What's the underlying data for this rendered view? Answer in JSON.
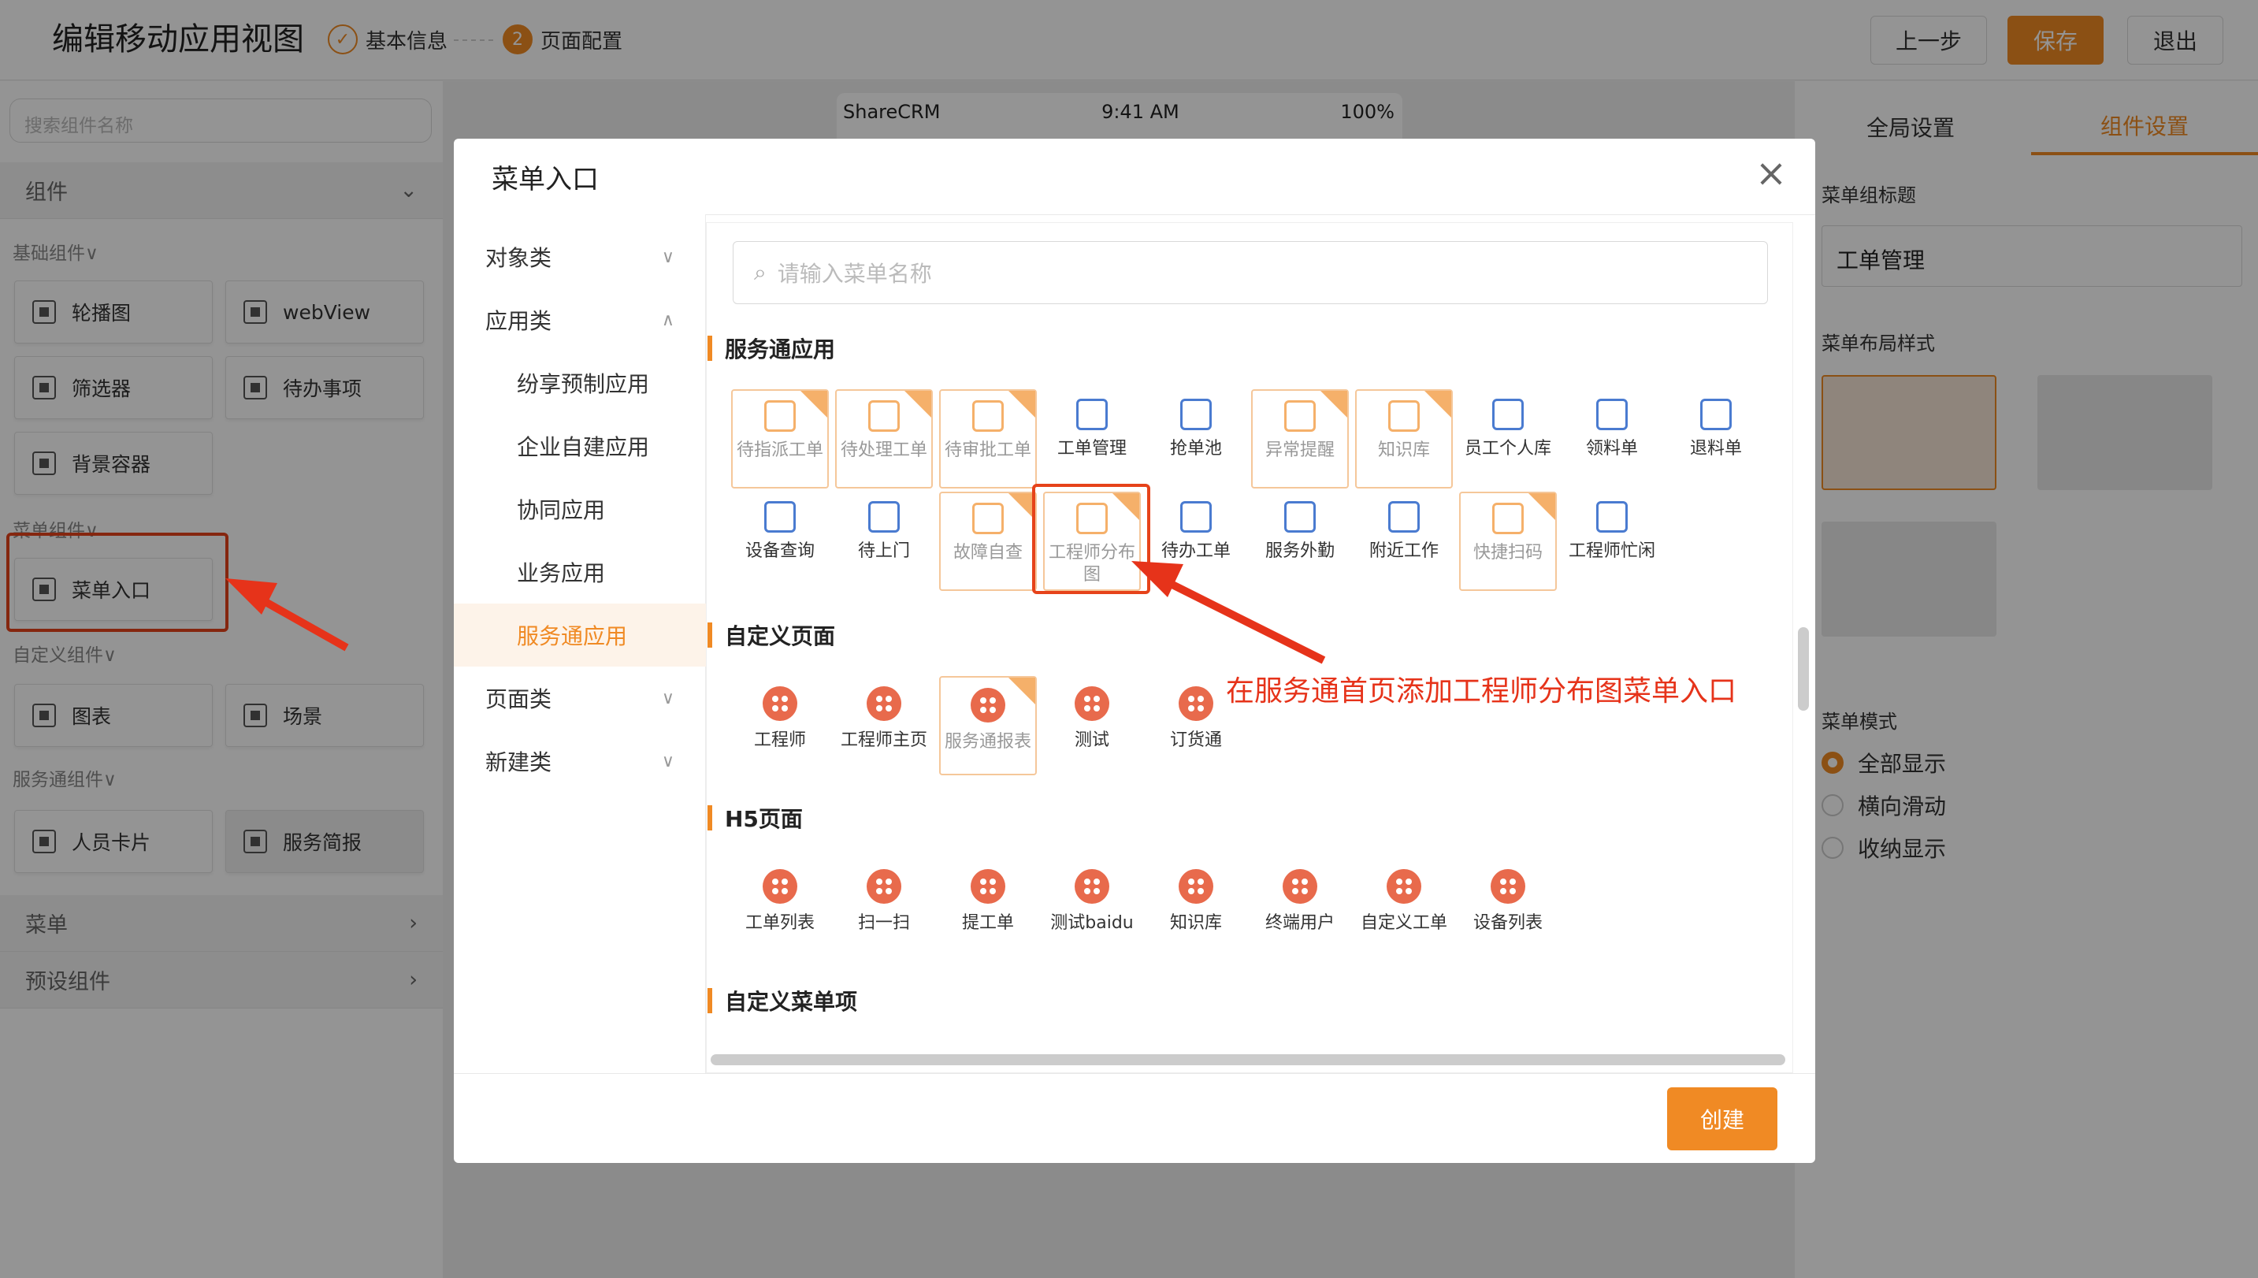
{
  "header": {
    "title": "编辑移动应用视图",
    "steps": [
      {
        "num": "✓",
        "label": "基本信息"
      },
      {
        "num": "2",
        "label": "页面配置"
      }
    ],
    "prev_label": "上一步",
    "save_label": "保存",
    "exit_label": "退出"
  },
  "left": {
    "search_placeholder": "搜索组件名称",
    "sections": {
      "components": "组件",
      "menu": "菜单",
      "preset": "预设组件"
    },
    "groups": {
      "basic": "基础组件∨",
      "menu": "菜单组件∨",
      "custom": "自定义组件∨",
      "service": "服务通组件∨"
    },
    "items": {
      "carousel": "轮播图",
      "webview": "webView",
      "filter": "筛选器",
      "todo": "待办事项",
      "bg": "背景容器",
      "menu_entry": "菜单入口",
      "chart": "图表",
      "scene": "场景",
      "person_card": "人员卡片",
      "service_brief": "服务简报"
    }
  },
  "phone": {
    "carrier": "ShareCRM",
    "time": "9:41 AM",
    "battery": "100%"
  },
  "right": {
    "tabs": [
      "全局设置",
      "组件设置"
    ],
    "title_label": "菜单组标题",
    "title_value": "工单管理",
    "layout_label": "菜单布局样式",
    "mode_label": "菜单模式",
    "modes": [
      "全部显示",
      "横向滑动",
      "收纳显示"
    ]
  },
  "modal": {
    "title": "菜单入口",
    "nav": {
      "object": "对象类",
      "app": "应用类",
      "sub": [
        "纷享预制应用",
        "企业自建应用",
        "协同应用",
        "业务应用",
        "服务通应用"
      ],
      "page": "页面类",
      "create": "新建类"
    },
    "search_placeholder": "请输入菜单名称",
    "sections": {
      "service": "服务通应用",
      "custom": "自定义页面",
      "h5": "H5页面",
      "custom_menu": "自定义菜单项"
    },
    "service_row1": [
      "待指派工单",
      "待处理工单",
      "待审批工单",
      "工单管理",
      "抢单池",
      "异常提醒",
      "知识库",
      "员工个人库",
      "领料单",
      "退料单"
    ],
    "service_row2": [
      "设备查询",
      "待上门",
      "故障自查",
      "工程师分布图",
      "待办工单",
      "服务外勤",
      "附近工作",
      "快捷扫码",
      "工程师忙闲"
    ],
    "custom_pages": [
      "工程师",
      "工程师主页",
      "服务通报表",
      "测试",
      "订货通"
    ],
    "h5_pages": [
      "工单列表",
      "扫一扫",
      "提工单",
      "测试baidu",
      "知识库",
      "终端用户",
      "自定义工单",
      "设备列表"
    ],
    "create_label": "创建"
  },
  "annotation": "在服务通首页添加工程师分布图菜单入口",
  "colors": {
    "accent": "#f08a24",
    "annotation": "#e6331a",
    "icon_blue": "#4a7bd0",
    "icon_red": "#e86a4c"
  }
}
